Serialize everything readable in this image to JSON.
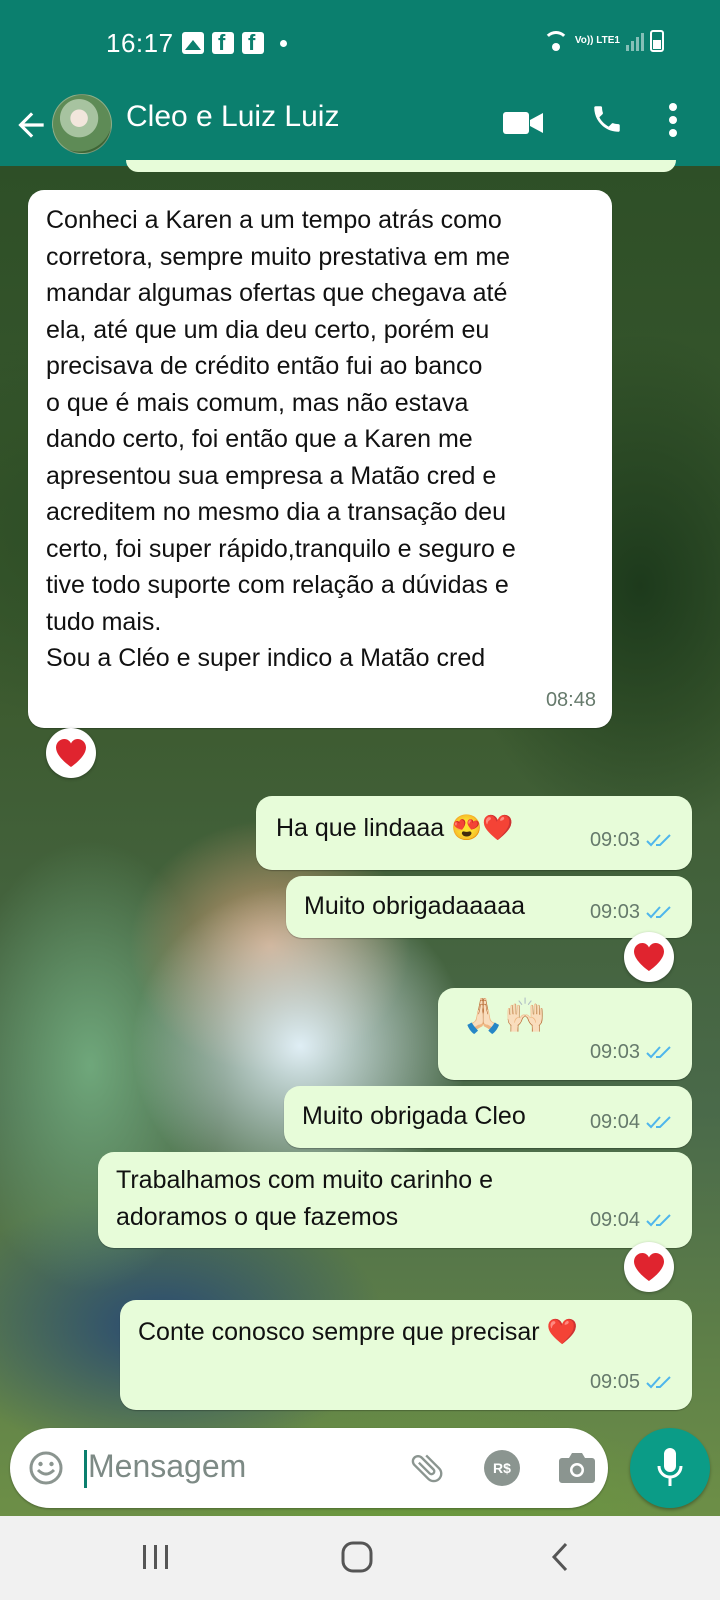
{
  "status_bar": {
    "time": "16:17",
    "network": "Vo)) LTE1"
  },
  "header": {
    "contact_name": "Cleo e Luiz Luiz"
  },
  "messages": [
    {
      "id": 1,
      "direction": "incoming",
      "text": "Conheci a Karen a um tempo atrás como\ncorretora, sempre muito prestativa em me\nmandar algumas ofertas que chegava até\nela, até que um dia deu certo, porém eu\nprecisava de crédito então fui ao banco\no que é mais comum, mas não estava\ndando certo, foi então que a Karen me\napresentou sua empresa a Matão cred e\nacreditem no mesmo dia a transação deu\ncerto, foi super rápido,tranquilo e seguro e\ntive todo suporte com relação a dúvidas e\ntudo mais.\nSou a Cléo e super indico a Matão cred",
      "time": "08:48",
      "reaction": "heart"
    },
    {
      "id": 2,
      "direction": "outgoing",
      "text": "Ha que lindaaa 😍❤️",
      "time": "09:03",
      "status": "read"
    },
    {
      "id": 3,
      "direction": "outgoing",
      "text": "Muito obrigadaaaaa",
      "time": "09:03",
      "status": "read",
      "reaction": "heart"
    },
    {
      "id": 4,
      "direction": "outgoing",
      "text": "🙏🏻🙌🏻",
      "time": "09:03",
      "status": "read"
    },
    {
      "id": 5,
      "direction": "outgoing",
      "text": "Muito obrigada Cleo",
      "time": "09:04",
      "status": "read"
    },
    {
      "id": 6,
      "direction": "outgoing",
      "text": "Trabalhamos com muito carinho e\nadoramos o que fazemos",
      "time": "09:04",
      "status": "read",
      "reaction": "heart"
    },
    {
      "id": 7,
      "direction": "outgoing",
      "text": "Conte conosco sempre que precisar ❤️",
      "time": "09:05",
      "status": "read"
    }
  ],
  "composer": {
    "placeholder": "Mensagem",
    "payment_label": "R$"
  },
  "colors": {
    "header": "#0b7f6e",
    "outgoing_bubble": "#e7fcd9",
    "incoming_bubble": "#ffffff",
    "read_ticks": "#4fb6ec",
    "mic_button": "#0b9c87",
    "heart": "#e0242f"
  },
  "icons": [
    "back-arrow-icon",
    "video-call-icon",
    "phone-icon",
    "more-options-icon",
    "emoji-icon",
    "attach-icon",
    "payment-icon",
    "camera-icon",
    "mic-icon",
    "double-check-icon",
    "heart-icon"
  ]
}
